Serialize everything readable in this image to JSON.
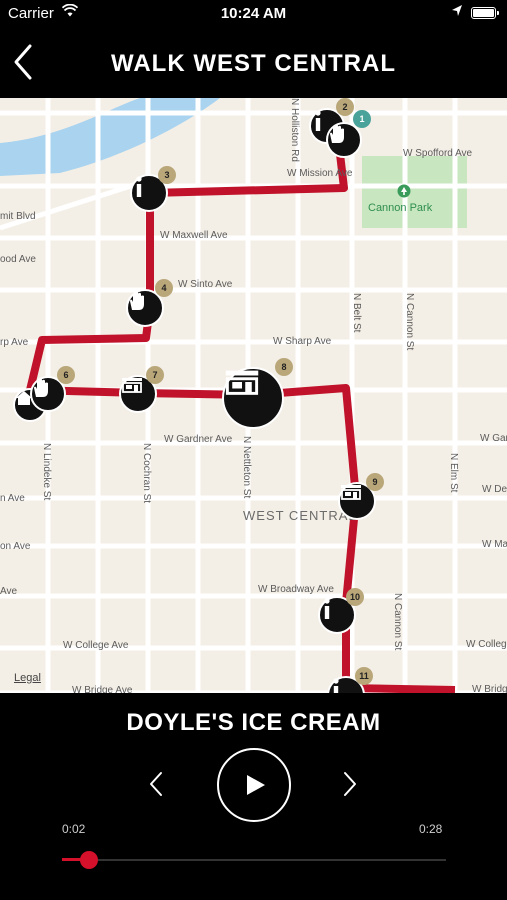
{
  "status_bar": {
    "carrier": "Carrier",
    "time": "10:24 AM"
  },
  "nav": {
    "title": "WALK WEST CENTRAL",
    "back_icon": "chevron-left-icon"
  },
  "map": {
    "area_label": "WEST CENTRAL",
    "park_label": "Cannon Park",
    "legal": "Legal",
    "streets": {
      "mission": "W Mission Ave",
      "spofford": "W Spofford Ave",
      "maxwell": "W Maxwell Ave",
      "summit": "mit Blvd",
      "boone": "ood Ave",
      "sinto": "W Sinto Ave",
      "sharp_left": "rp Ave",
      "sharp": "W Sharp Ave",
      "gardner": "W Gardner Ave",
      "gardner_right": "W Gar",
      "dean_left": "n Ave",
      "dean_right": "W De",
      "mansfield_left": "on Ave",
      "mansfield_right": "W Ma",
      "boone2_left": "Ave",
      "broadway": "W Broadway Ave",
      "college": "W College Ave",
      "college_right": "W Colleg",
      "bridge": "W Bridge Ave",
      "bridge_right": "W Bridg",
      "holliston": "N Holliston Rd",
      "belt": "N Belt St",
      "cannon_top": "N Cannon St",
      "cannon_bottom": "N Cannon St",
      "elm": "N Elm St",
      "lindeke": "N Lindeke St",
      "cochran": "N Cochran St",
      "nettleton": "N Nettleton St"
    },
    "stops": [
      {
        "number": "1",
        "type": "hand",
        "icon": "hand-icon"
      },
      {
        "number": "2",
        "type": "info",
        "icon": "info-icon"
      },
      {
        "number": "3",
        "type": "info",
        "icon": "info-icon"
      },
      {
        "number": "4",
        "type": "hand",
        "icon": "hand-icon"
      },
      {
        "number": "5",
        "type": "house",
        "icon": "house-icon"
      },
      {
        "number": "6",
        "type": "hand",
        "icon": "hand-icon"
      },
      {
        "number": "7",
        "type": "storefront",
        "icon": "storefront-icon"
      },
      {
        "number": "8",
        "type": "storefront",
        "icon": "storefront-icon",
        "selected": true
      },
      {
        "number": "9",
        "type": "storefront",
        "icon": "storefront-icon"
      },
      {
        "number": "10",
        "type": "info",
        "icon": "info-icon"
      },
      {
        "number": "11",
        "type": "info",
        "icon": "info-icon"
      }
    ],
    "route_color": "#c0122a",
    "park_color": "#c8e6c0"
  },
  "player": {
    "stop_title": "DOYLE'S ICE CREAM",
    "elapsed": "0:02",
    "duration": "0:28",
    "progress_fraction": 0.07,
    "accent": "#d4102a"
  }
}
